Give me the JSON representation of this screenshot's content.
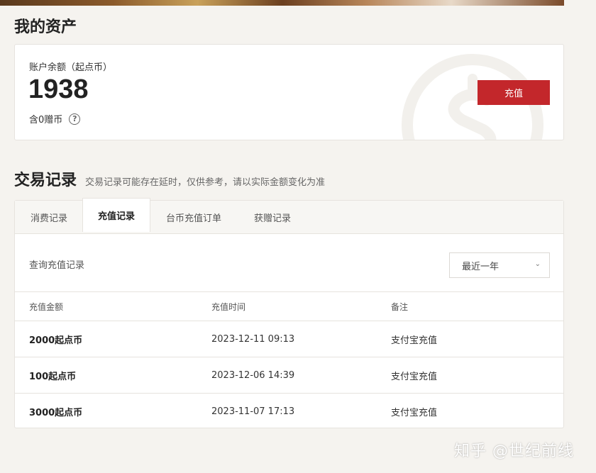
{
  "assets": {
    "title": "我的资产",
    "balance_label": "账户余额（起点币）",
    "balance_value": "1938",
    "gift_text": "含0赠币",
    "help_glyph": "?",
    "recharge_label": "充值"
  },
  "transactions": {
    "title": "交易记录",
    "note": "交易记录可能存在延时，仅供参考，请以实际金额变化为准",
    "tabs": [
      {
        "label": "消费记录",
        "active": false
      },
      {
        "label": "充值记录",
        "active": true
      },
      {
        "label": "台币充值订单",
        "active": false
      },
      {
        "label": "获赠记录",
        "active": false
      }
    ],
    "query_label": "查询充值记录",
    "range_select": "最近一年",
    "columns": [
      "充值金额",
      "充值时间",
      "备注"
    ],
    "rows": [
      {
        "amount": "2000起点币",
        "time": "2023-12-11 09:13",
        "note": "支付宝充值"
      },
      {
        "amount": "100起点币",
        "time": "2023-12-06 14:39",
        "note": "支付宝充值"
      },
      {
        "amount": "3000起点币",
        "time": "2023-11-07 17:13",
        "note": "支付宝充值"
      }
    ]
  },
  "watermark": "知乎 @世纪前线",
  "colors": {
    "accent": "#c3272b",
    "background": "#f5f3ef"
  }
}
